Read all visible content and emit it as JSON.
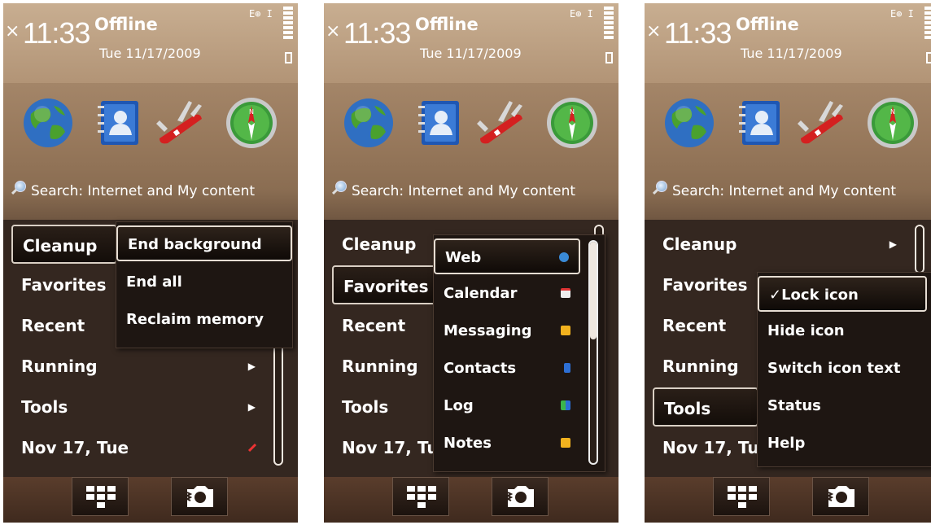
{
  "screens": [
    {
      "status": {
        "close_glyph": "×",
        "time": "11:33",
        "profile": "Offline",
        "date": "Tue 11/17/2009",
        "indicators": "E⊕ 𝙸"
      },
      "search_label": "Search: Internet and My content",
      "menu": [
        "Cleanup",
        "Favorites",
        "Recent",
        "Running",
        "Tools",
        "Nov 17, Tue"
      ],
      "selected_menu": "Cleanup",
      "submenu": [
        "End background",
        "End all",
        "Reclaim memory"
      ],
      "selected_submenu": "End background"
    },
    {
      "status": {
        "close_glyph": "×",
        "time": "11:33",
        "profile": "Offline",
        "date": "Tue 11/17/2009",
        "indicators": "E⊕ 𝙸"
      },
      "search_label": "Search: Internet and My content",
      "menu": [
        "Cleanup",
        "Favorites",
        "Recent",
        "Running",
        "Tools",
        "Nov 17, Tu"
      ],
      "selected_menu": "Favorites",
      "submenu": [
        "Web",
        "Calendar",
        "Messaging",
        "Contacts",
        "Log",
        "Notes"
      ],
      "selected_submenu": "Web"
    },
    {
      "status": {
        "close_glyph": "×",
        "time": "11:33",
        "profile": "Offline",
        "date": "Tue 11/17/2009",
        "indicators": "E⊕ 𝙸"
      },
      "search_label": "Search: Internet and My content",
      "menu": [
        "Cleanup",
        "Favorites",
        "Recent",
        "Running",
        "Tools",
        "Nov 17, Tu"
      ],
      "selected_menu": "Tools",
      "submenu": [
        "✓Lock icon",
        "Hide icon",
        "Switch icon text",
        "Status",
        "Help"
      ],
      "selected_submenu": "✓Lock icon"
    }
  ],
  "icons": {
    "shortcuts": [
      "globe-icon",
      "contacts-icon",
      "swiss-knife-icon",
      "compass-icon"
    ],
    "bottom": [
      "menu-grid-icon",
      "camera-icon"
    ],
    "favorites_icons": [
      "globe-icon",
      "calendar-icon",
      "envelope-icon",
      "contact-icon",
      "log-icon",
      "note-icon"
    ]
  },
  "colors": {
    "top_brown": "#b49676",
    "list_bg": "#342720",
    "popup_bg": "#1e1612",
    "text": "#ffffff"
  }
}
